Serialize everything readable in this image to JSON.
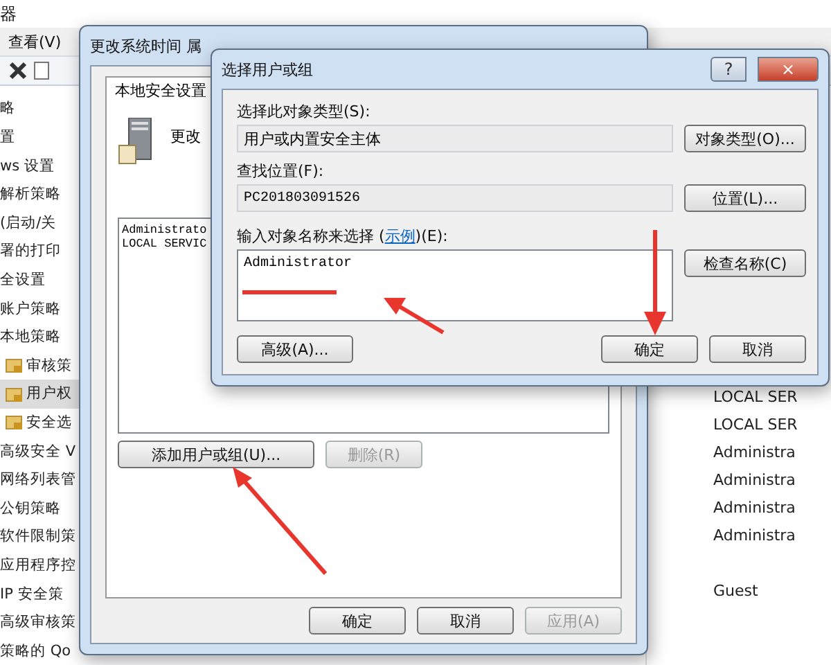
{
  "console": {
    "title": "器",
    "menu": [
      "查看(V)"
    ],
    "tree": [
      {
        "label": "略"
      },
      {
        "label": "置"
      },
      {
        "label": "ws 设置"
      },
      {
        "label": "解析策略"
      },
      {
        "label": "(启动/关"
      },
      {
        "label": "署的打印"
      },
      {
        "label": "全设置"
      },
      {
        "label": "账户策略"
      },
      {
        "label": "本地策略",
        "children": [
          {
            "label": "审核策",
            "kind": "folder",
            "selected": false
          },
          {
            "label": "用户权",
            "kind": "folder",
            "selected": true
          },
          {
            "label": "安全选",
            "kind": "folder",
            "selected": false
          }
        ]
      },
      {
        "label": "高级安全 V"
      },
      {
        "label": "网络列表管"
      },
      {
        "label": "公钥策略"
      },
      {
        "label": "软件限制策"
      },
      {
        "label": "应用程序控"
      },
      {
        "label": "IP 安全策"
      },
      {
        "label": "高级审核策"
      },
      {
        "label": "策略的 Qo"
      }
    ],
    "details": [
      "LOCAL SER",
      "LOCAL SER",
      "Administra",
      "Administra",
      "Administra",
      "Administra"
    ],
    "details_lower": [
      "Guest"
    ]
  },
  "properties": {
    "title": "更改系统时间 属",
    "tabs": [
      {
        "label": "本地安全设置",
        "selected": true
      }
    ],
    "policy": "更改",
    "members": [
      "Administrato",
      "LOCAL SERVIC"
    ],
    "add_button": {
      "label": "添加用户或组(U)...",
      "disabled": false
    },
    "remove_button": {
      "label": "删除(R)",
      "disabled": true
    },
    "buttons": [
      {
        "label": "确定",
        "disabled": false
      },
      {
        "label": "取消",
        "disabled": false
      },
      {
        "label": "应用(A)",
        "disabled": true
      }
    ]
  },
  "select_dialog": {
    "title": "选择用户或组",
    "help": "?",
    "close": "×",
    "type_label": "选择此对象类型(S):",
    "type_value": "用户或内置安全主体",
    "type_button": "对象类型(O)...",
    "location_label": "查找位置(F):",
    "location_value": "PC201803091526",
    "location_button": "位置(L)...",
    "names_label_before": "输入对象名称来选择 (",
    "names_link": "示例",
    "names_label_after": ")(E):",
    "names_value": "Administrator",
    "check_button": "检查名称(C)",
    "advanced_button": "高级(A)...",
    "buttons": [
      "确定",
      "取消"
    ]
  }
}
